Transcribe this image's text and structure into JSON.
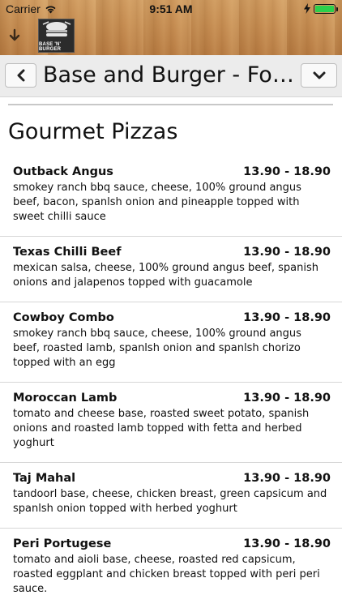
{
  "status_bar": {
    "carrier": "Carrier",
    "time": "9:51 AM",
    "battery_level": 1.0,
    "battery_color": "#2bd04b"
  },
  "toolbar": {
    "back_icon": "arrow-down-icon",
    "logo_text": "BASE 'N' BURGER"
  },
  "header": {
    "title": "Base and Burger - Forrestdale",
    "prev_icon": "chevron-left-icon",
    "next_icon": "chevron-down-icon"
  },
  "section": {
    "title": "Gourmet Pizzas"
  },
  "items": [
    {
      "name": "Outback Angus",
      "price": "13.90 - 18.90",
      "description": "smokey ranch bbq sauce, cheese, 100% ground angus beef, bacon, spanlsh onion and pineapple topped with sweet chilli sauce"
    },
    {
      "name": "Texas Chilli Beef",
      "price": "13.90 - 18.90",
      "description": "mexican salsa, cheese, 100% ground angus beef, spanish onions and jalapenos topped with guacamole"
    },
    {
      "name": "Cowboy Combo",
      "price": "13.90 - 18.90",
      "description": "smokey ranch bbq sauce, cheese, 100% ground angus beef, roasted lamb, spanlsh onion and spanlsh chorizo topped with an egg"
    },
    {
      "name": "Moroccan Lamb",
      "price": "13.90 - 18.90",
      "description": "tomato and cheese base, roasted sweet potato, spanish onions and roasted lamb topped with fetta and herbed yoghurt"
    },
    {
      "name": "Taj Mahal",
      "price": "13.90 - 18.90",
      "description": "tandoorl base, cheese, chicken breast, green capsicum and spanlsh onion topped with herbed yoghurt"
    },
    {
      "name": "Peri Portugese",
      "price": "13.90 - 18.90",
      "description": "tomato and aioli base, cheese, roasted red capsicum, roasted eggplant and chicken breast topped with peri peri sauce."
    }
  ]
}
